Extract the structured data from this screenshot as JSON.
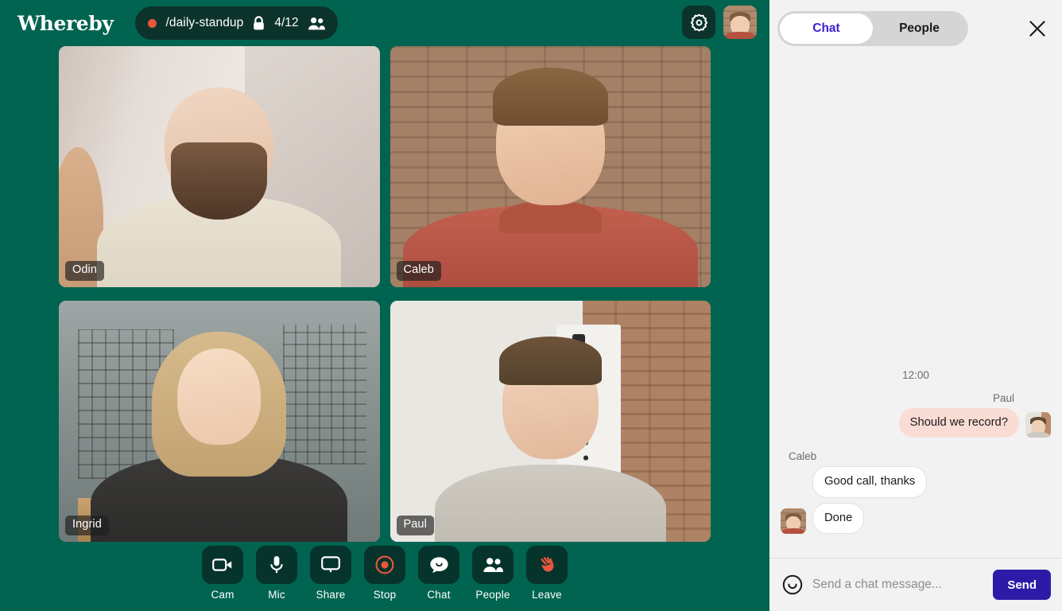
{
  "brand": {
    "logo_text": "Whereby"
  },
  "header": {
    "room_name": "/daily-standup",
    "participant_count": "4/12",
    "recording_indicator": "recording-dot",
    "lock_icon": "lock-icon",
    "people_icon": "people-icon",
    "settings_icon": "gear-icon",
    "avatar_name": "Caleb"
  },
  "stage": {
    "tiles": [
      {
        "name": "Odin"
      },
      {
        "name": "Caleb"
      },
      {
        "name": "Ingrid"
      },
      {
        "name": "Paul"
      }
    ]
  },
  "toolbar": {
    "items": [
      {
        "label": "Cam",
        "icon": "camera-icon"
      },
      {
        "label": "Mic",
        "icon": "microphone-icon"
      },
      {
        "label": "Share",
        "icon": "screen-share-icon"
      },
      {
        "label": "Stop",
        "icon": "record-stop-icon"
      },
      {
        "label": "Chat",
        "icon": "chat-bubble-icon"
      },
      {
        "label": "People",
        "icon": "people-icon"
      },
      {
        "label": "Leave",
        "icon": "waving-hand-icon"
      }
    ]
  },
  "panel": {
    "tabs": [
      {
        "label": "Chat",
        "active": true
      },
      {
        "label": "People",
        "active": false
      }
    ],
    "close_icon": "close-icon",
    "chat": {
      "timestamp": "12:00",
      "groups": [
        {
          "author": "Paul",
          "direction": "out",
          "messages": [
            "Should we record?"
          ]
        },
        {
          "author": "Caleb",
          "direction": "in",
          "messages": [
            "Good call, thanks",
            "Done"
          ]
        }
      ]
    },
    "composer": {
      "emoji_icon": "emoji-smiley-icon",
      "placeholder": "Send a chat message...",
      "input_value": "",
      "send_label": "Send"
    }
  },
  "colors": {
    "stage_green": "#006450",
    "pill_dark": "#0C332B",
    "accent_red": "#E8563C",
    "panel_bg": "#F2F2F2",
    "tab_active_text": "#3B1FD1",
    "send_button": "#2D1BA8",
    "bubble_out": "#F9DCD4",
    "bubble_in": "#FFFFFF"
  }
}
